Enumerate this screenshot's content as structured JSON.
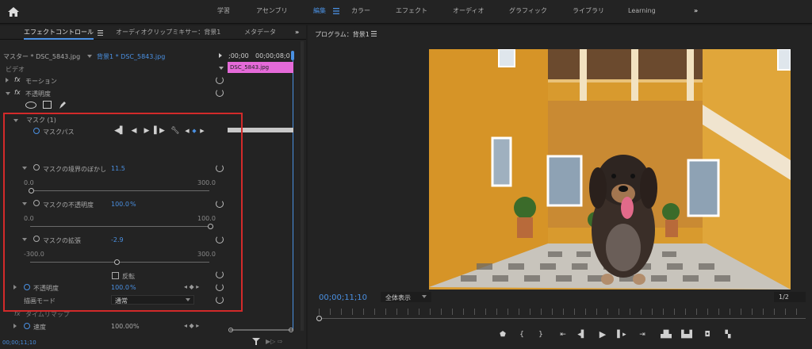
{
  "topbar": {
    "workspaces": [
      "学習",
      "アセンブリ",
      "編集",
      "カラー",
      "エフェクト",
      "オーディオ",
      "グラフィック",
      "ライブラリ",
      "Learning"
    ],
    "active": "編集"
  },
  "left_tabs": {
    "effect_controls": "エフェクトコントロール",
    "audio_mixer": "オーディオクリップミキサー：背景1",
    "metadata": "メタデータ"
  },
  "source": {
    "master": "マスター * DSC_5843.jpg",
    "clip": "背景1 * DSC_5843.jpg",
    "tc1": ";00;00",
    "tc2": "00;00;08;0",
    "clip_label": "DSC_5843.jpg"
  },
  "effects": {
    "video_header": "ビデオ",
    "motion": "モーション",
    "opacity": "不透明度",
    "mask": "マスク (1)",
    "mask_path": "マスクパス",
    "feather_label": "マスクの境界のぼかし",
    "feather_value": "11.5",
    "feather_min": "0.0",
    "feather_max": "300.0",
    "mask_opacity_label": "マスクの不透明度",
    "mask_opacity_value": "100.0",
    "mask_opacity_unit": "%",
    "mo_min": "0.0",
    "mo_max": "100.0",
    "expansion_label": "マスクの拡張",
    "expansion_value": "-2.9",
    "exp_min": "-300.0",
    "exp_max": "300.0",
    "invert_label": "反転",
    "opacity_label": "不透明度",
    "opacity_value": "100.0",
    "opacity_unit": "%",
    "blend_label": "描画モード",
    "blend_value": "通常",
    "time_remap": "タイムリマップ",
    "speed_label": "速度",
    "speed_value": "100.00%",
    "bottom_tc": "00;00;11;10"
  },
  "program": {
    "title": "プログラム：背景1",
    "timecode": "00;00;11;10",
    "zoom": "全体表示",
    "resolution": "1/2"
  },
  "colors": {
    "accent": "#4a90e2",
    "highlight": "#d22a2a",
    "clip": "#e56ad9"
  }
}
